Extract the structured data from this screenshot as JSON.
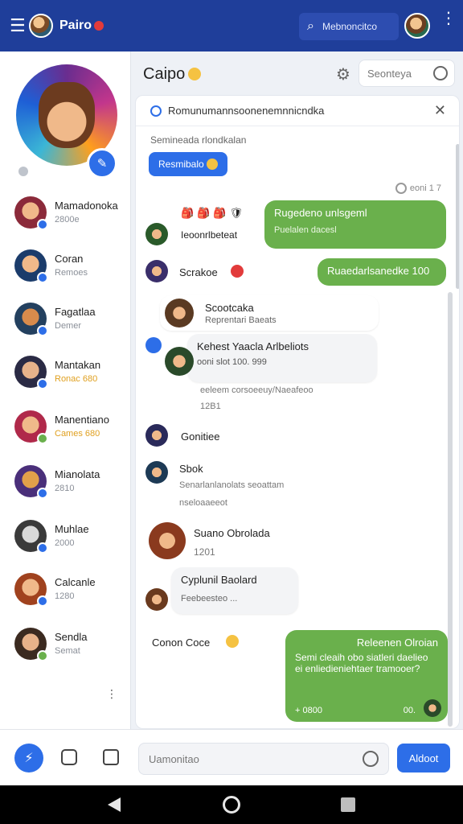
{
  "topbar": {
    "app_name": "Pairo",
    "search_label": "Mebnoncitco"
  },
  "sidebar": {
    "contacts": [
      {
        "name": "Mamadonoka",
        "meta": "2800e"
      },
      {
        "name": "Coran",
        "meta": "Remoes"
      },
      {
        "name": "Fagatlaa",
        "meta": "Demer"
      },
      {
        "name": "Mantakan",
        "meta": "Ronac 680"
      },
      {
        "name": "Manentiano",
        "meta": "Cames 680"
      },
      {
        "name": "Mianolata",
        "meta": "2810"
      },
      {
        "name": "Muhlae",
        "meta": "2000"
      },
      {
        "name": "Calcanle",
        "meta": "1280"
      },
      {
        "name": "Sendla",
        "meta": "Semat"
      }
    ]
  },
  "chat": {
    "title": "Caipo",
    "search_placeholder": "Seonteya",
    "panel_title": "Romunumannsoonenemnnicndka",
    "system_text": "Semineada rlondkalan",
    "action_button": "Resmibalo",
    "time_label": "eoni 1 7",
    "messages": [
      {
        "kind": "out",
        "title": "Rugedeno unlsgeml",
        "sub": "Puelalen dacesl"
      },
      {
        "kind": "in",
        "title": "Ieoonrlbeteat"
      },
      {
        "kind": "named",
        "name": "Scrakoe"
      },
      {
        "kind": "out",
        "title": "Ruaedarlsanedke 100"
      },
      {
        "kind": "in",
        "title": "Scootcaka",
        "sub": "Reprentari Baeats"
      },
      {
        "kind": "in",
        "title": "Kehest Yaacla Arlbeliots",
        "sub": "ooni slot 100. 999"
      },
      {
        "kind": "info",
        "title": "eeleem corsoeeuy/Naeafeoo",
        "sub": "12B1"
      },
      {
        "kind": "named",
        "name": "Gonitiee"
      },
      {
        "kind": "in",
        "title": "Sbok",
        "sub": "Senarlanlanolats seoattam",
        "sub2": "nseloaaeeot"
      },
      {
        "kind": "in",
        "title": "Suano Obrolada",
        "sub": "1201"
      },
      {
        "kind": "in",
        "title": "Cyplunil Baolard",
        "sub": "Feebeesteo ..."
      },
      {
        "kind": "named",
        "name": "Conon Coce"
      },
      {
        "kind": "out",
        "title": "Releenen Olroian",
        "sub": "Semi cleaih obo siatleri daelieo ei enliedieniehtaer tramooer?",
        "foot_left": "+ 0800",
        "foot_right": "00."
      }
    ],
    "input_placeholder": "Uamonitao",
    "send_label": "Aldoot"
  },
  "colors": {
    "primary": "#1f3e9a",
    "accent": "#2d6ee8",
    "outgoing": "#6ab04c"
  }
}
